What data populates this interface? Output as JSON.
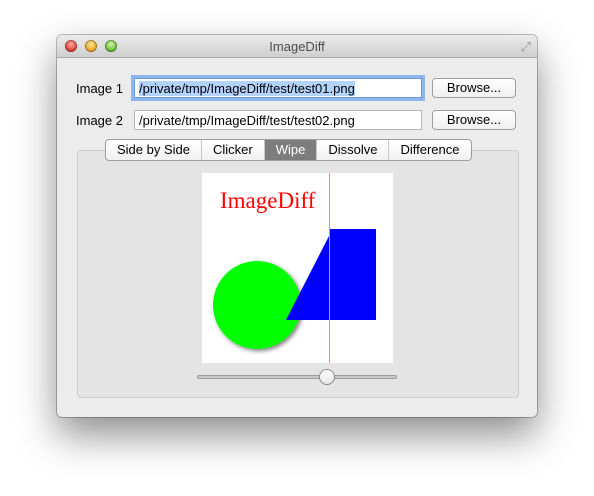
{
  "window": {
    "title": "ImageDiff"
  },
  "image1": {
    "label": "Image 1",
    "path": "/private/tmp/ImageDiff/test/test01.png",
    "browse_label": "Browse..."
  },
  "image2": {
    "label": "Image 2",
    "path": "/private/tmp/ImageDiff/test/test02.png",
    "browse_label": "Browse..."
  },
  "tabs": [
    {
      "label": "Side by Side"
    },
    {
      "label": "Clicker"
    },
    {
      "label": "Wipe",
      "active": true
    },
    {
      "label": "Dissolve"
    },
    {
      "label": "Difference"
    }
  ],
  "preview": {
    "logo_text": "ImageDiff",
    "logo_color": "#ff0000",
    "circle_color": "#00ff00",
    "shape_color": "#0000ff",
    "wipe_line_color": "#ff8080"
  },
  "wipe_slider": {
    "value_percent": 65
  },
  "colors": {
    "selection": "#b3d3fd",
    "focus_ring": "#8fb6ea",
    "active_tab": "#7d7d7d"
  }
}
